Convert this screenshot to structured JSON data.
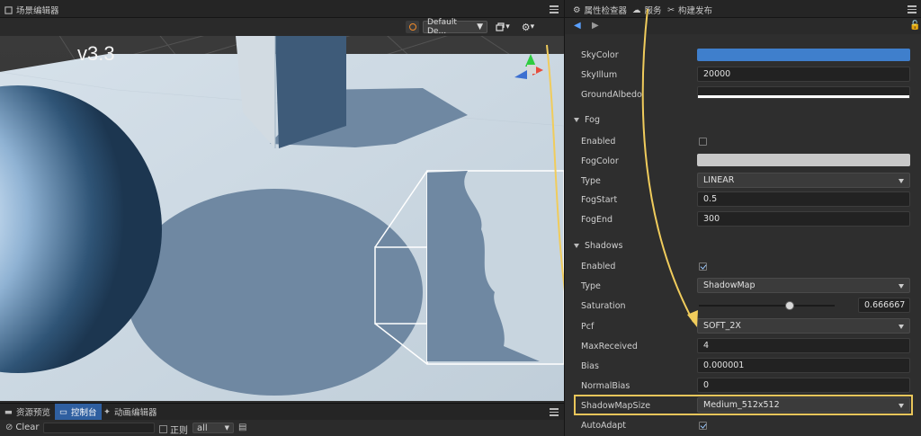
{
  "version_label": "v3.3",
  "scene": {
    "tab_label": "场景编辑器",
    "preset": "Default De...",
    "gizmo_arrow": "▾",
    "settings_arrow": "▾"
  },
  "console": {
    "tabs": [
      {
        "label": "资源预览"
      },
      {
        "label": "控制台"
      },
      {
        "label": "动画编辑器"
      }
    ],
    "clear_label": "Clear",
    "regex_label": "正则",
    "filter_value": "all"
  },
  "inspector": {
    "tabs": [
      {
        "label": "属性检查器"
      },
      {
        "label": "服务"
      },
      {
        "label": "构建发布"
      }
    ],
    "ambient": {
      "sky_color_label": "SkyColor",
      "sky_color": "#3f7fcc",
      "sky_illum_label": "SkyIllum",
      "sky_illum_value": "20000",
      "ground_albedo_label": "GroundAlbedo",
      "ground_albedo_color": "#ffffff"
    },
    "fog": {
      "header": "Fog",
      "enabled_label": "Enabled",
      "enabled": false,
      "fog_color_label": "FogColor",
      "fog_color": "#c8c8c8",
      "type_label": "Type",
      "type_value": "LINEAR",
      "fog_start_label": "FogStart",
      "fog_start_value": "0.5",
      "fog_end_label": "FogEnd",
      "fog_end_value": "300"
    },
    "shadows": {
      "header": "Shadows",
      "enabled_label": "Enabled",
      "enabled": true,
      "type_label": "Type",
      "type_value": "ShadowMap",
      "saturation_label": "Saturation",
      "saturation_value": "0.666667",
      "saturation_fraction": 0.666667,
      "pcf_label": "Pcf",
      "pcf_value": "SOFT_2X",
      "max_received_label": "MaxReceived",
      "max_received_value": "4",
      "bias_label": "Bias",
      "bias_value": "0.000001",
      "normal_bias_label": "NormalBias",
      "normal_bias_value": "0",
      "map_size_label": "ShadowMapSize",
      "map_size_value": "Medium_512x512",
      "auto_adapt_label": "AutoAdapt",
      "auto_adapt": true
    }
  },
  "colors": {
    "highlight": "#e9c65a",
    "arrow": "#f0cc5c",
    "active_tab": "#2f5fa0"
  }
}
